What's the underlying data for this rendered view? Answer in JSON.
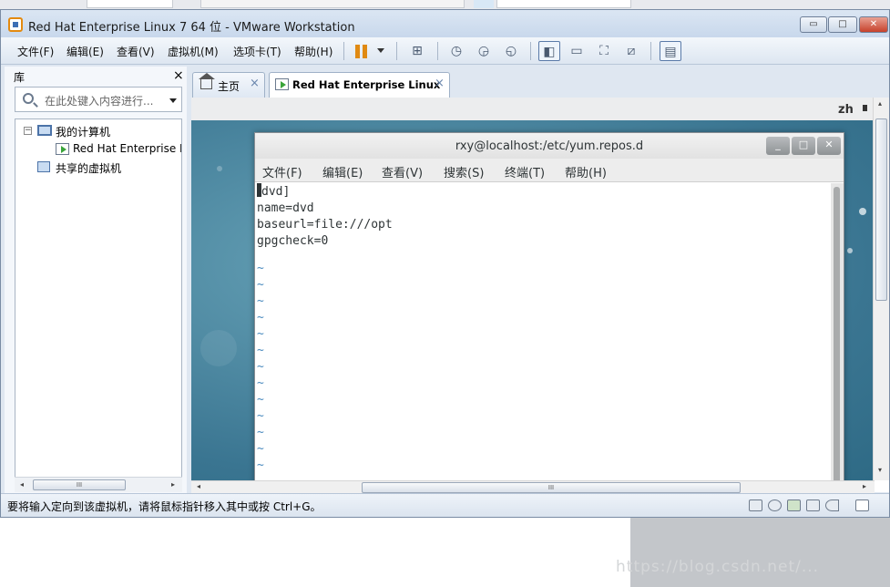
{
  "window": {
    "title": "Red Hat Enterprise Linux 7 64 位 - VMware Workstation",
    "min_glyph": "▭",
    "max_glyph": "□",
    "close_glyph": "✕"
  },
  "menubar": {
    "items": [
      "文件(F)",
      "编辑(E)",
      "查看(V)",
      "虚拟机(M)",
      "选项卡(T)",
      "帮助(H)"
    ],
    "toolbar_icons": [
      "pause-icon",
      "send-ctrl-alt-del-icon",
      "snapshot-icon",
      "revert-snapshot-icon",
      "snapshot-manager-icon",
      "console-view-icon",
      "quick-switch-icon",
      "full-screen-icon",
      "unity-icon",
      "thumbnail-icon"
    ]
  },
  "library": {
    "title": "库",
    "close": "×",
    "search_placeholder": "在此处键入内容进行...",
    "tree": {
      "my_computer": "我的计算机",
      "vm_name": "Red Hat Enterprise L",
      "shared_vms": "共享的虚拟机",
      "expander": "−"
    },
    "hscroll_grip": "III"
  },
  "tabs": [
    {
      "label": "主页",
      "close": "×"
    },
    {
      "label": "Red Hat Enterprise Linux ...",
      "close": "×"
    }
  ],
  "guest": {
    "lang_indicator": "zh",
    "terminal": {
      "title": "rxy@localhost:/etc/yum.repos.d",
      "buttons": [
        "_",
        "□",
        "✕"
      ],
      "menu": [
        "文件(F)",
        "编辑(E)",
        "查看(V)",
        "搜索(S)",
        "终端(T)",
        "帮助(H)"
      ],
      "lines": [
        "dvd]",
        "name=dvd",
        "baseurl=file:///opt",
        "gpgcheck=0"
      ],
      "tilde": "~"
    },
    "hscroll_grip": "III"
  },
  "status": {
    "text": "要将输入定向到该虚拟机，请将鼠标指针移入其中或按 Ctrl+G。",
    "icons": [
      "hard-disk-icon",
      "cd-dvd-icon",
      "network-icon",
      "printer-icon",
      "sound-icon",
      "message-icon"
    ]
  },
  "watermark": "https://blog.csdn.net/..."
}
